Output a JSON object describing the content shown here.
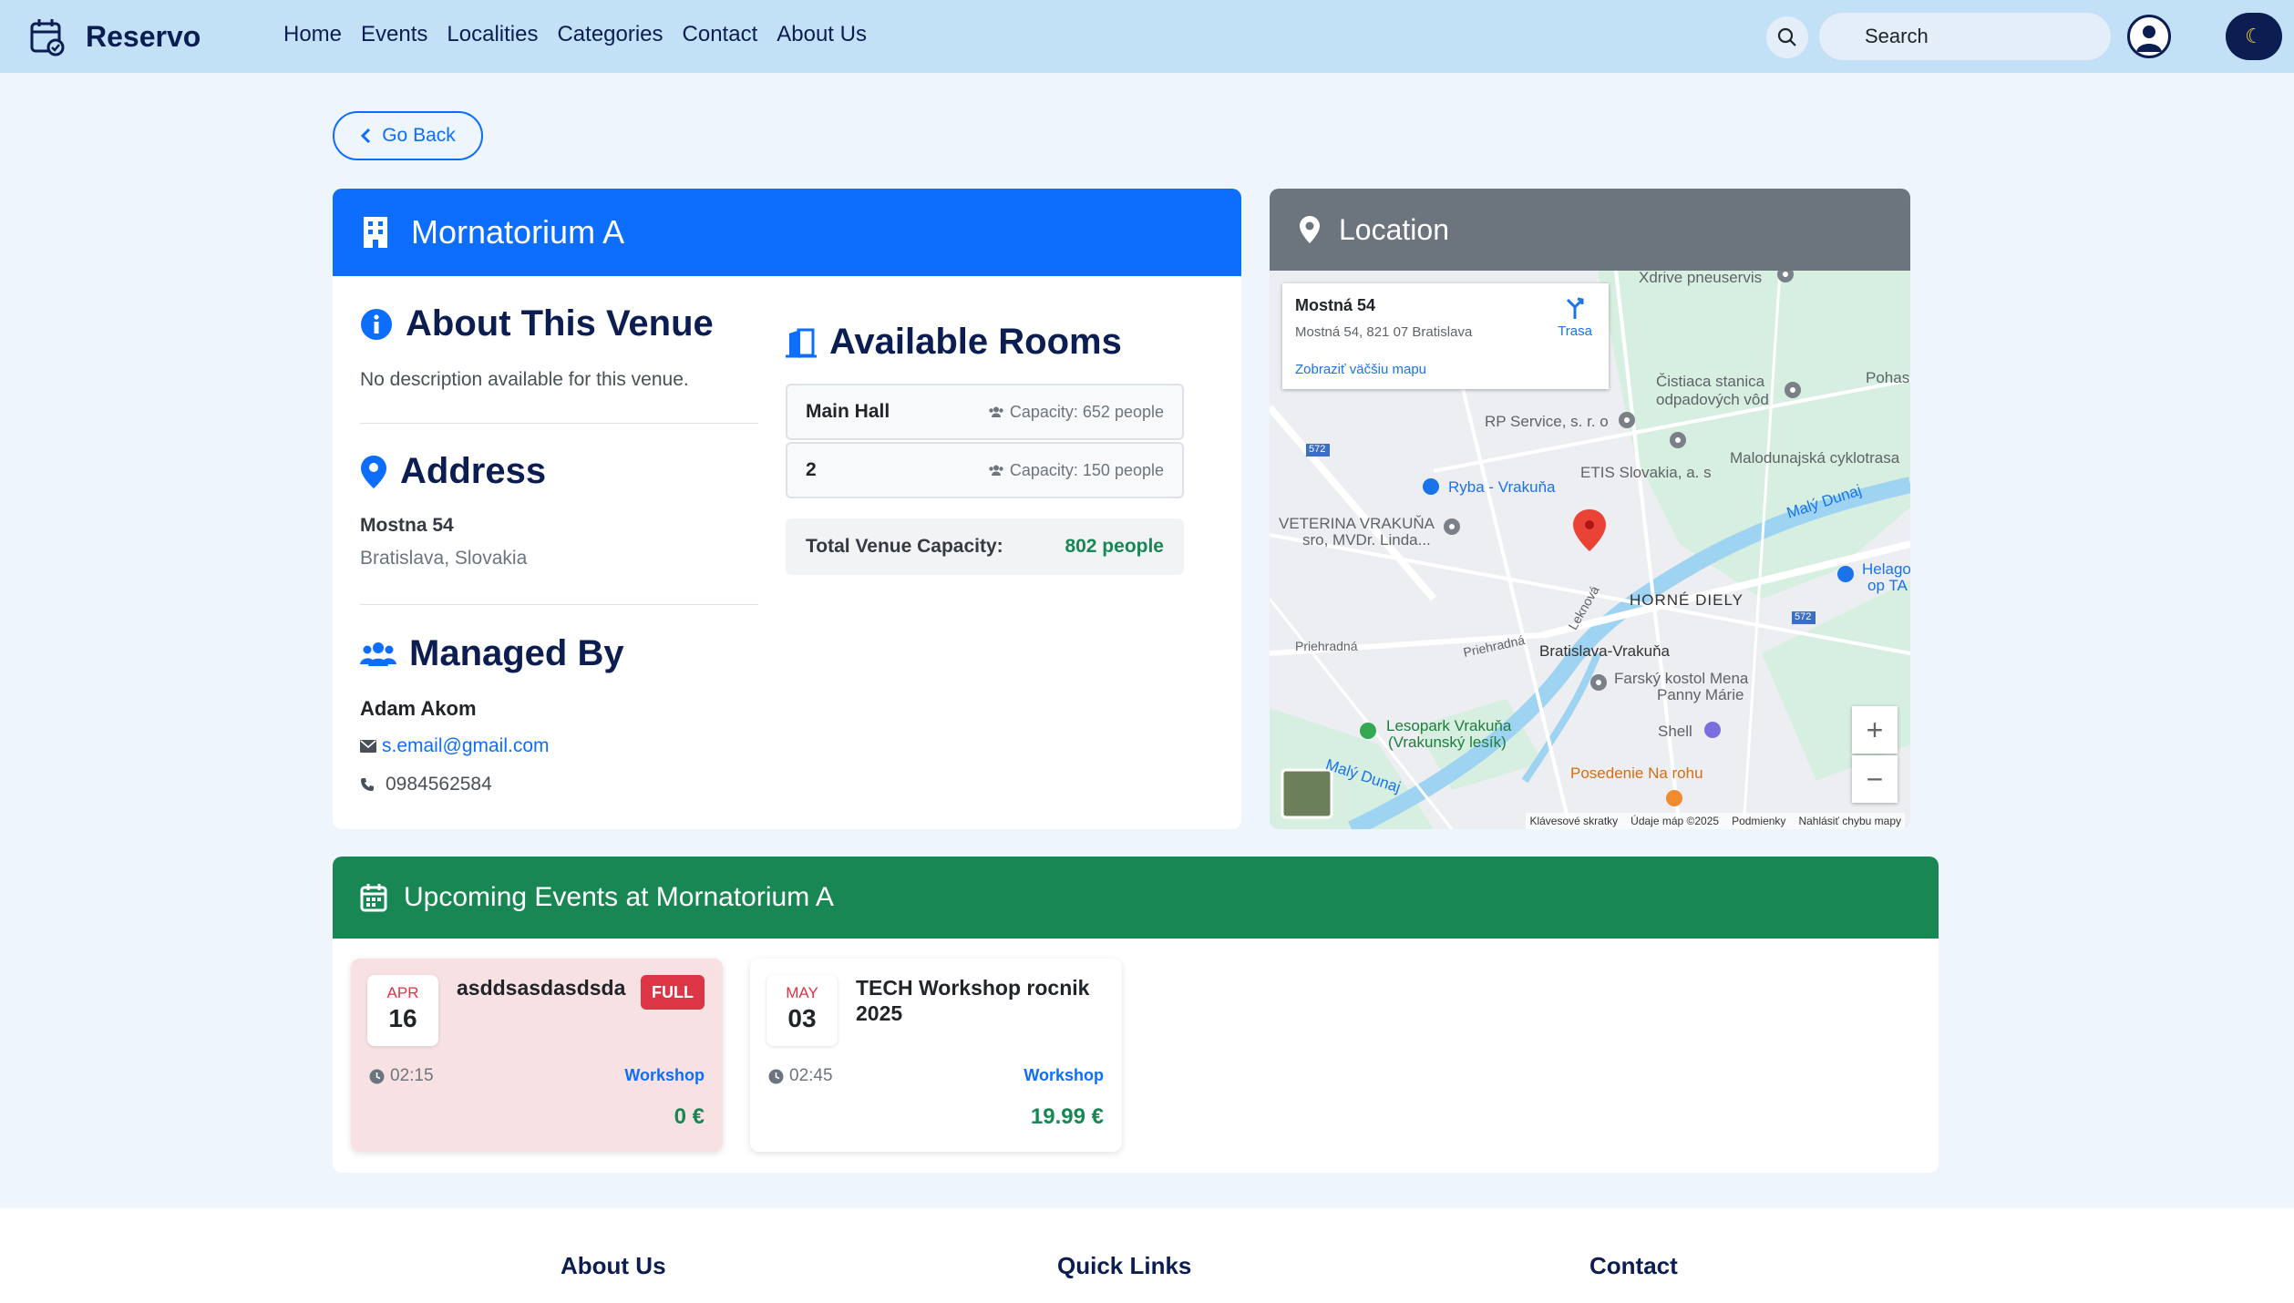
{
  "brand": {
    "name": "Reservo"
  },
  "nav": {
    "items": [
      "Home",
      "Events",
      "Localities",
      "Categories",
      "Contact",
      "About Us"
    ]
  },
  "search": {
    "placeholder": "Search"
  },
  "theme": {
    "icon": "moon-icon"
  },
  "back": {
    "label": "Go Back"
  },
  "venue": {
    "name": "Mornatorium A",
    "about_title": "About This Venue",
    "description": "No description available for this venue.",
    "address_title": "Address",
    "street": "Mostna 54",
    "city": "Bratislava, Slovakia",
    "managed_title": "Managed By",
    "manager_name": "Adam Akom",
    "manager_email": "s.email@gmail.com",
    "manager_phone": "0984562584"
  },
  "rooms": {
    "title": "Available Rooms",
    "items": [
      {
        "name": "Main Hall",
        "capacity": "Capacity: 652 people"
      },
      {
        "name": "2",
        "capacity": "Capacity: 150 people"
      }
    ],
    "total_label": "Total Venue Capacity:",
    "total_value": "802 people"
  },
  "location": {
    "title": "Location",
    "info_title": "Mostná 54",
    "info_address": "Mostná 54, 821 07 Bratislava",
    "info_link": "Zobraziť väčšiu mapu",
    "directions": "Trasa",
    "labels": {
      "xdrive": "Xdrive pneuservis",
      "cistiaca": "Čistiaca stanica",
      "odpadovych": "odpadových vôd",
      "pohas": "Pohas",
      "rp": "RP Service, s. r. o",
      "etis": "ETIS Slovakia, a. s",
      "malodunajska": "Malodunajská cyklotrasa",
      "ryba": "Ryba - Vrakuňa",
      "veterina": "VETERINA VRAKUŇA",
      "veterina2": "sro, MVDr. Linda...",
      "maly_dunaj": "Malý Dunaj",
      "helago": "Helago",
      "helago2": "op TA",
      "horne_diely": "HORNÉ DIELY",
      "priehradna1": "Priehradná",
      "priehradna2": "Priehradná",
      "lekova": "Leknová",
      "bratislava_vrakuna": "Bratislava-Vrakuňa",
      "farsky": "Farský kostol Mena",
      "panny": "Panny Márie",
      "lesopark": "Lesopark Vrakuňa",
      "vrakunsky": "(Vrakunský lesík)",
      "shell": "Shell",
      "posedenie": "Posedenie Na rohu",
      "maly_dunaj2": "Malý Dunaj",
      "road572a": "572",
      "road572b": "572"
    },
    "footer": [
      "Klávesové skratky",
      "Údaje máp ©2025",
      "Podmienky",
      "Nahlásiť chybu mapy"
    ]
  },
  "events": {
    "title": "Upcoming Events at Mornatorium A",
    "items": [
      {
        "month": "APR",
        "day": "16",
        "title": "asddsasdasdsda",
        "badge": "FULL",
        "time": "02:15",
        "category": "Workshop",
        "price": "0 €"
      },
      {
        "month": "MAY",
        "day": "03",
        "title": "TECH Workshop rocnik 2025",
        "time": "02:45",
        "category": "Workshop",
        "price": "19.99 €"
      }
    ]
  },
  "footer": {
    "about": "About Us",
    "quick": "Quick Links",
    "contact": "Contact"
  },
  "colors": {
    "primary": "#0d6efd",
    "success": "#198754",
    "secondary": "#6c757d",
    "navy": "#0b1d51",
    "danger": "#dc3545"
  }
}
